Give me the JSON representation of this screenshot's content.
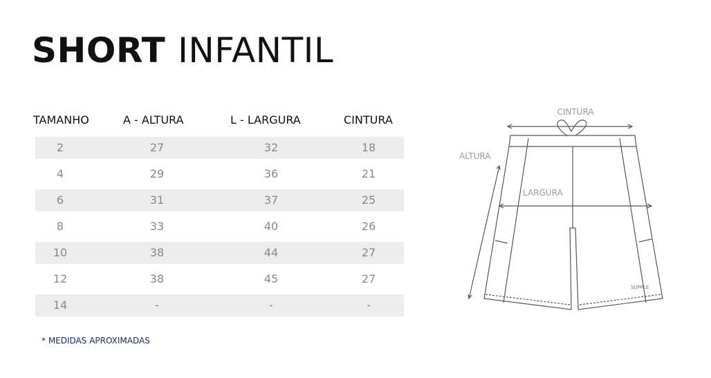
{
  "title": {
    "bold": "SHORT",
    "light": "INFANTIL"
  },
  "table": {
    "headers": [
      "TAMANHO",
      "A - ALTURA",
      "L - LARGURA",
      "CINTURA"
    ],
    "rows": [
      [
        "2",
        "27",
        "32",
        "18"
      ],
      [
        "4",
        "29",
        "36",
        "21"
      ],
      [
        "6",
        "31",
        "37",
        "25"
      ],
      [
        "8",
        "33",
        "40",
        "26"
      ],
      [
        "10",
        "38",
        "44",
        "27"
      ],
      [
        "12",
        "38",
        "45",
        "27"
      ],
      [
        "14",
        "-",
        "-",
        "-"
      ]
    ]
  },
  "note": "* MEDIDAS APROXIMADAS",
  "diagram": {
    "labels": {
      "cintura": "CINTURA",
      "altura": "ALTURA",
      "largura": "LARGURA"
    },
    "brand": "SUPPLE"
  },
  "colors": {
    "text": "#111111",
    "muted": "#888888",
    "shade": "#ececec",
    "note": "#1a2a6c",
    "diagram_line": "#555555"
  }
}
